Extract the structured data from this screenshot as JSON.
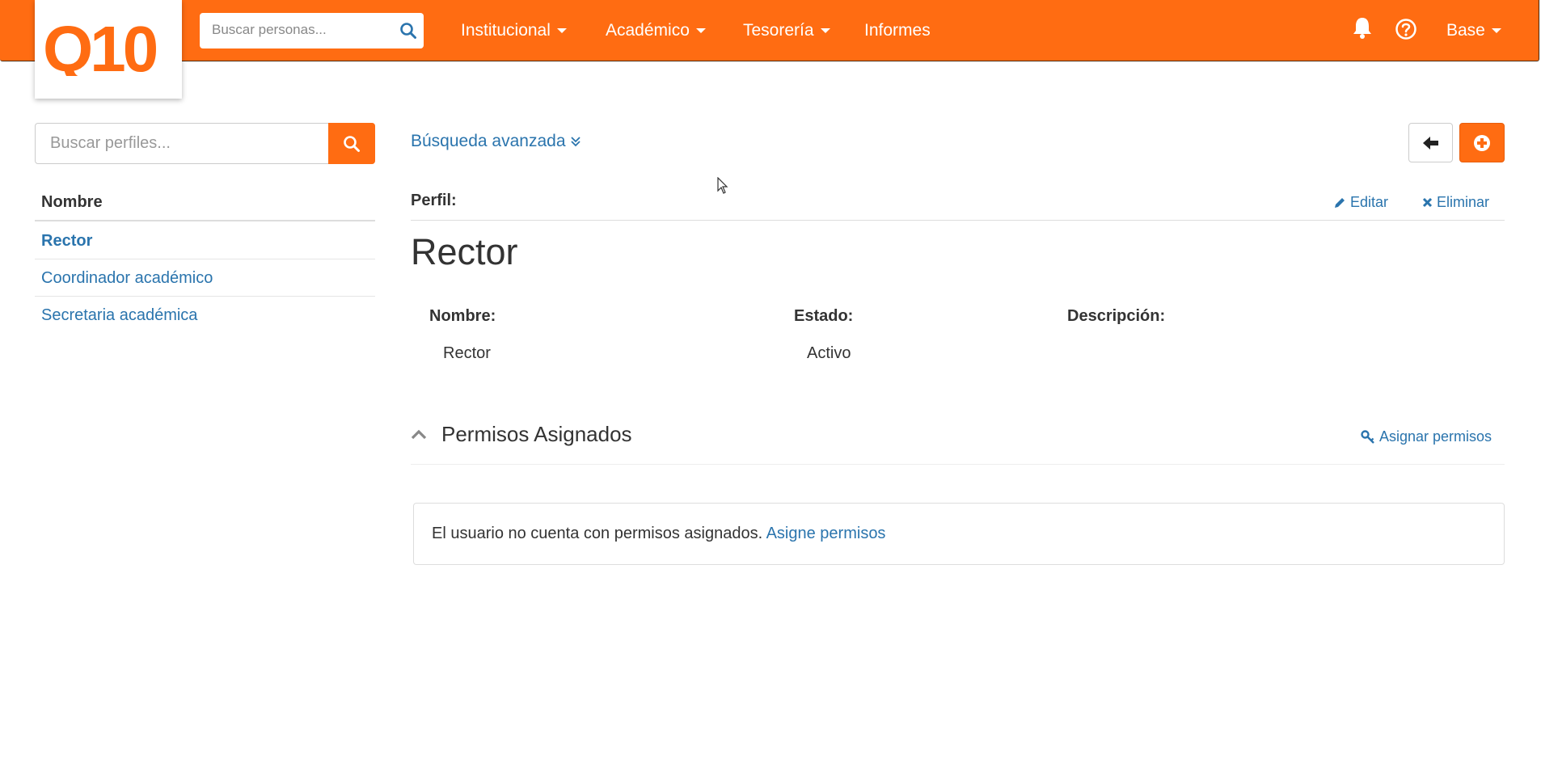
{
  "colors": {
    "accent": "#ff6c12",
    "link": "#2a74ad",
    "text": "#333333"
  },
  "logo": {
    "text": "Q10"
  },
  "topbar": {
    "search_placeholder": "Buscar personas...",
    "nav": [
      {
        "label": "Institucional",
        "has_dropdown": true
      },
      {
        "label": "Académico",
        "has_dropdown": true
      },
      {
        "label": "Tesorería",
        "has_dropdown": true
      },
      {
        "label": "Informes",
        "has_dropdown": false
      }
    ],
    "user_menu": {
      "label": "Base",
      "has_dropdown": true
    },
    "icons": [
      "bell-icon",
      "question-circle-icon"
    ]
  },
  "sidebar": {
    "search_placeholder": "Buscar perfiles...",
    "column_header": "Nombre",
    "items": [
      {
        "label": "Rector",
        "selected": true
      },
      {
        "label": "Coordinador académico",
        "selected": false
      },
      {
        "label": "Secretaria académica",
        "selected": false
      }
    ]
  },
  "main": {
    "advanced_search": "Búsqueda avanzada",
    "perfil_label": "Perfil:",
    "edit_label": "Editar",
    "delete_label": "Eliminar",
    "title": "Rector",
    "fields": [
      {
        "label": "Nombre:",
        "value": "Rector"
      },
      {
        "label": "Estado:",
        "value": "Activo"
      },
      {
        "label": "Descripción:",
        "value": ""
      }
    ],
    "permissions": {
      "title": "Permisos Asignados",
      "assign_label": "Asignar permisos",
      "empty_message": "El usuario no cuenta con permisos asignados.",
      "empty_link": "Asigne permisos"
    }
  }
}
